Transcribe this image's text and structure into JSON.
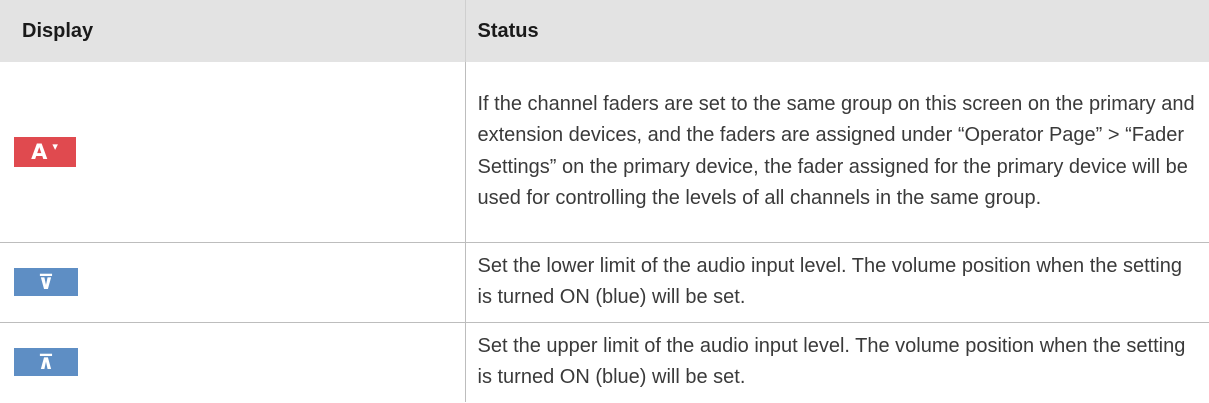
{
  "table": {
    "headers": {
      "display": "Display",
      "status": "Status"
    },
    "rows": [
      {
        "icon": {
          "name": "group-a-dropdown-icon",
          "text": "A",
          "caret": "▾",
          "color": "#e04a4f"
        },
        "status": "If the channel faders are set to the same group on this screen on the primary and extension devices, and the faders are assigned under “Operator Page” > “Fader Settings” on the primary device, the fader assigned for the primary device will be used for controlling the levels of all channels in the same group."
      },
      {
        "icon": {
          "name": "lower-limit-icon",
          "text": "⊽",
          "color": "#5e8ec4"
        },
        "status": "Set the lower limit of the audio input level. The volume position when the setting is turned ON (blue) will be set."
      },
      {
        "icon": {
          "name": "upper-limit-icon",
          "text": "⊼",
          "color": "#5e8ec4"
        },
        "status": "Set the upper limit of the audio input level. The volume position when the setting is turned ON (blue) will be set."
      }
    ]
  }
}
